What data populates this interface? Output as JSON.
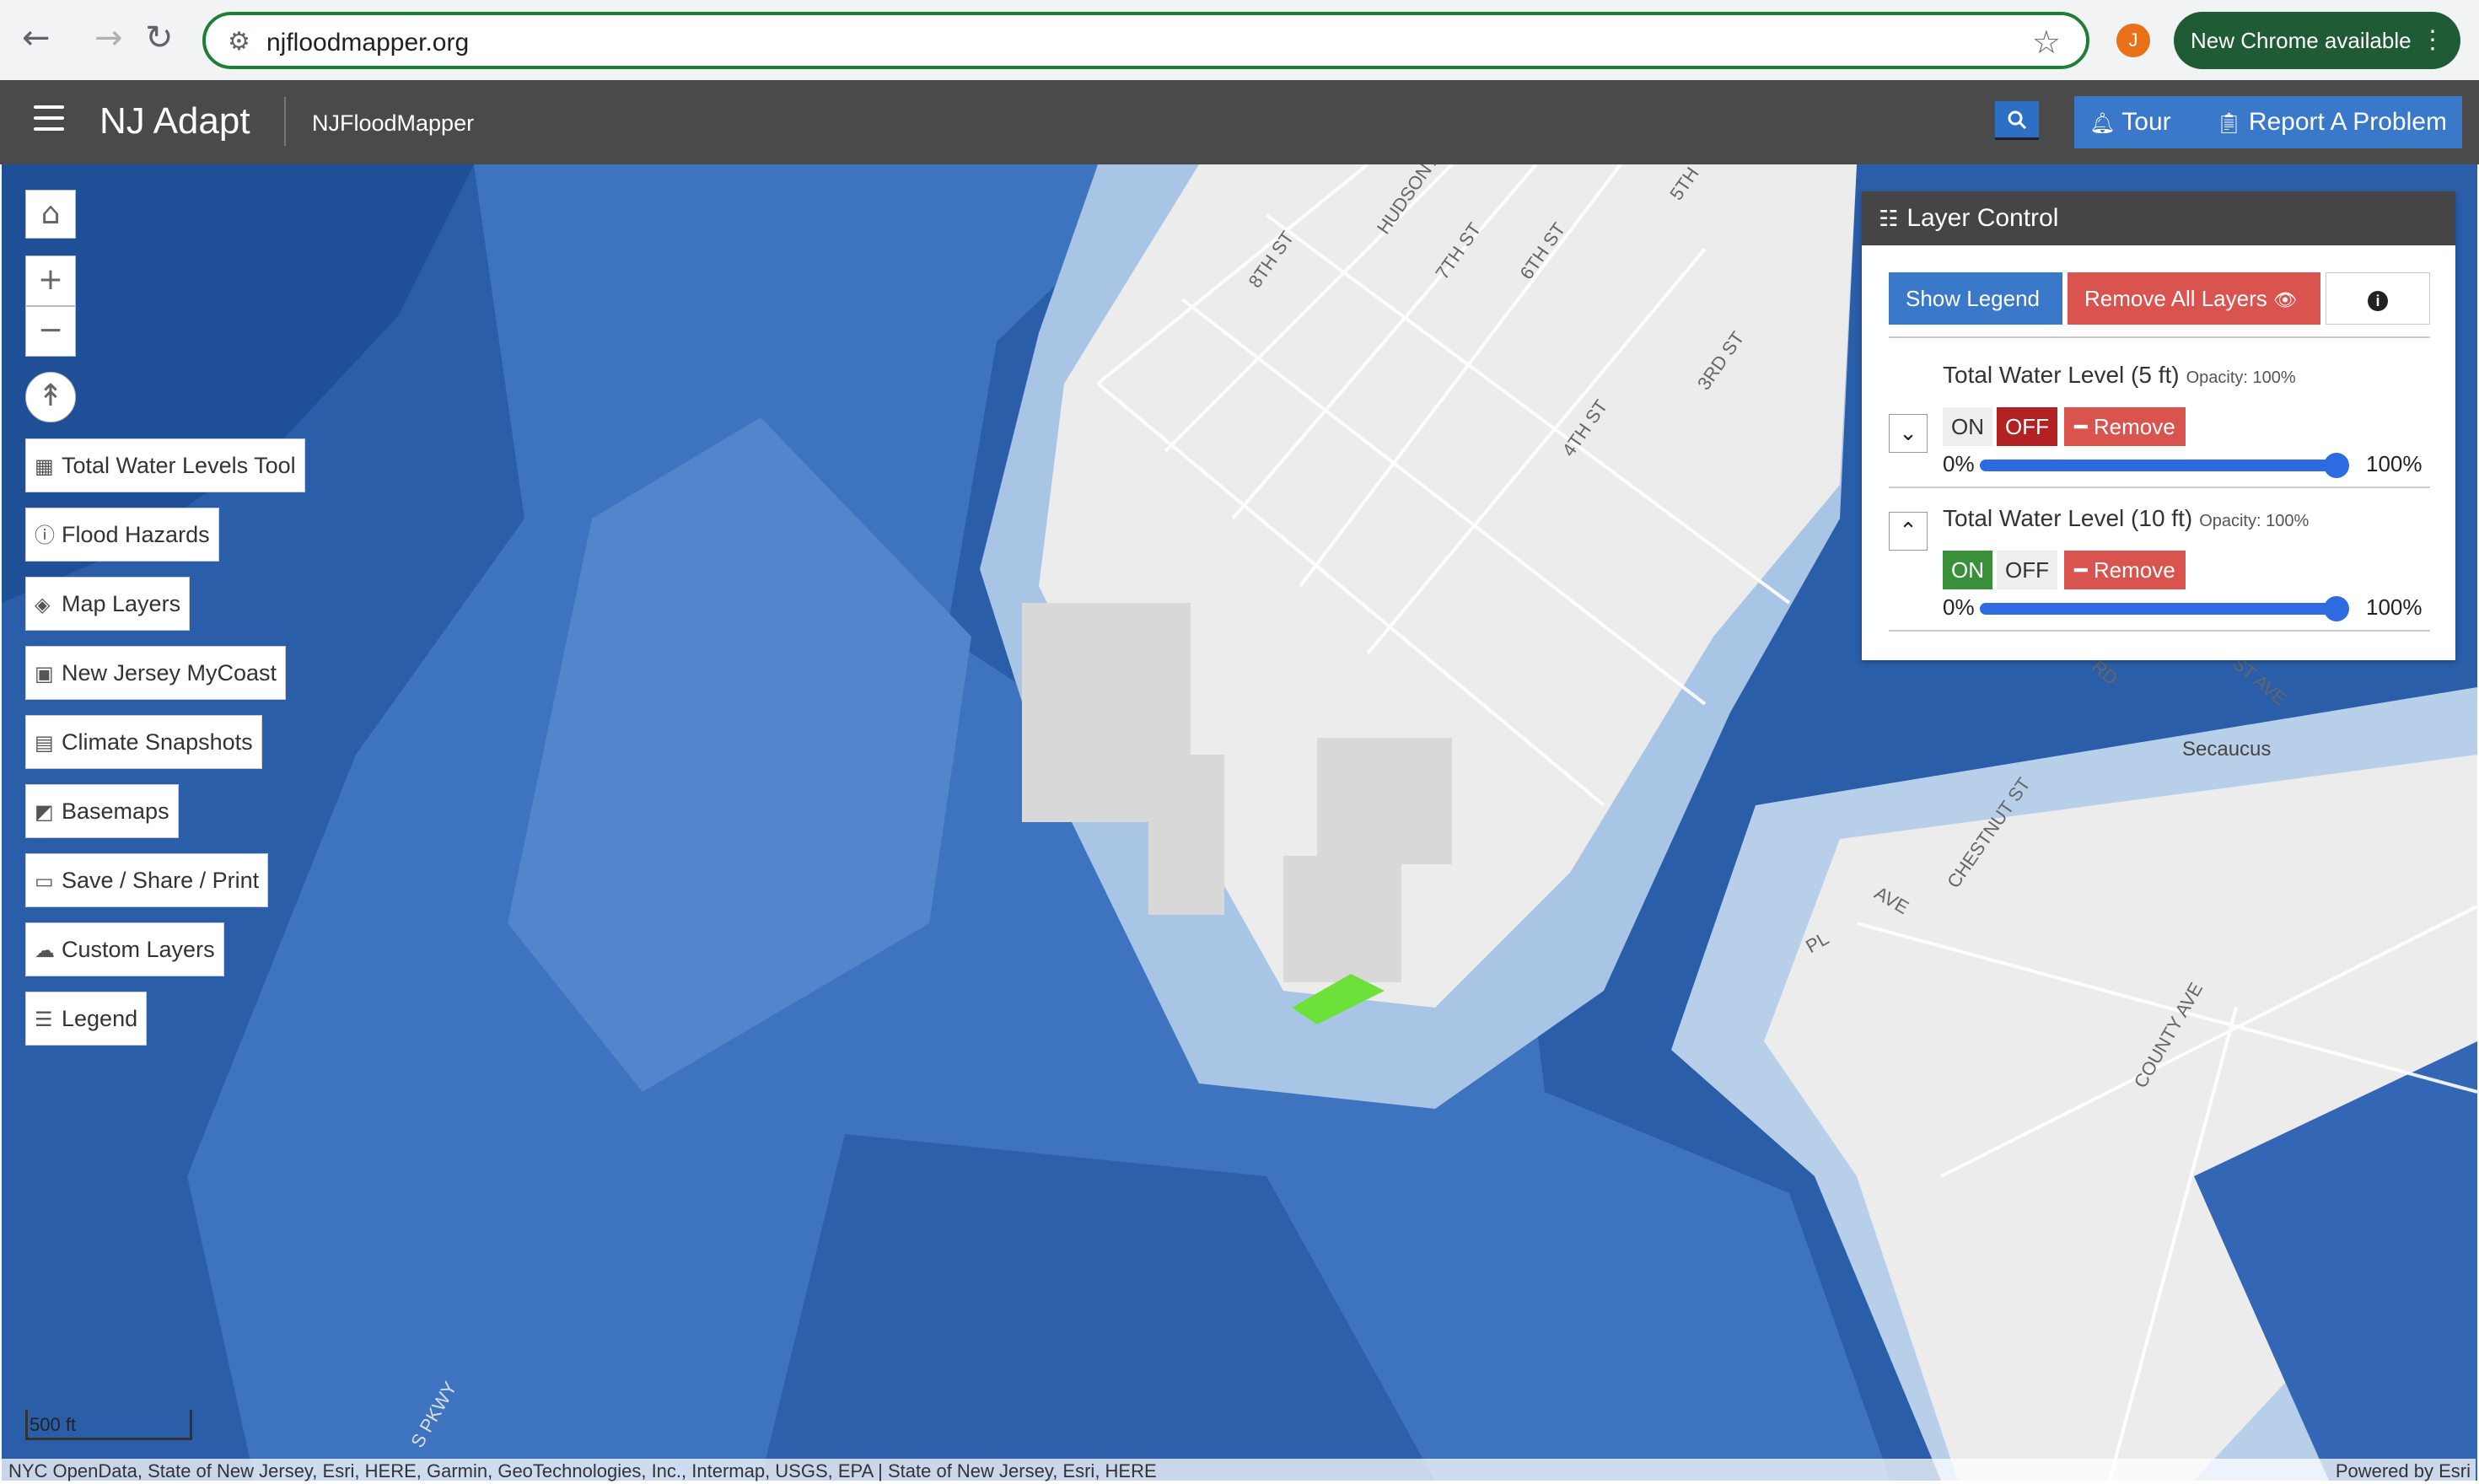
{
  "browser": {
    "url": "njfloodmapper.org",
    "profile_initial": "J",
    "update_label": "New Chrome available"
  },
  "app": {
    "brand": "NJ Adapt",
    "subtitle": "NJFloodMapper",
    "tour_label": "Tour",
    "report_label": "Report A Problem"
  },
  "tools": [
    {
      "label": "Total Water Levels Tool",
      "icon": "water-levels-icon"
    },
    {
      "label": "Flood Hazards",
      "icon": "info-circle-icon"
    },
    {
      "label": "Map Layers",
      "icon": "layers-icon"
    },
    {
      "label": "New Jersey MyCoast",
      "icon": "image-icon"
    },
    {
      "label": "Climate Snapshots",
      "icon": "snapshot-icon"
    },
    {
      "label": "Basemaps",
      "icon": "basemap-icon"
    },
    {
      "label": "Save / Share / Print",
      "icon": "save-icon"
    },
    {
      "label": "Custom Layers",
      "icon": "upload-icon"
    },
    {
      "label": "Legend",
      "icon": "list-icon"
    }
  ],
  "layer_control": {
    "title": "Layer Control",
    "show_legend": "Show Legend",
    "remove_all": "Remove All Layers",
    "layers": [
      {
        "title": "Total Water Level (5 ft)",
        "opacity_label": "Opacity: 100%",
        "on": "ON",
        "off": "OFF",
        "remove": "Remove",
        "min": "0%",
        "max": "100%",
        "state": "off",
        "opacity": 1.0,
        "expanded": false
      },
      {
        "title": "Total Water Level (10 ft)",
        "opacity_label": "Opacity: 100%",
        "on": "ON",
        "off": "OFF",
        "remove": "Remove",
        "min": "0%",
        "max": "100%",
        "state": "on",
        "opacity": 1.0,
        "expanded": true
      }
    ]
  },
  "map": {
    "scale_label": "500 ft",
    "attribution": "NYC OpenData, State of New Jersey, Esri, HERE, Garmin, GeoTechnologies, Inc., Intermap, USGS, EPA | State of New Jersey, Esri, HERE",
    "powered_by": "Powered by Esri",
    "labels": [
      "Secaucus",
      "8TH ST",
      "HUDSON A",
      "7TH ST",
      "6TH ST",
      "5TH",
      "3RD ST",
      "4TH ST",
      "CHESTNUT ST",
      "COUNTY AVE",
      "AVE",
      "PL",
      "ST AVE",
      "RD",
      "S PKWY"
    ]
  }
}
